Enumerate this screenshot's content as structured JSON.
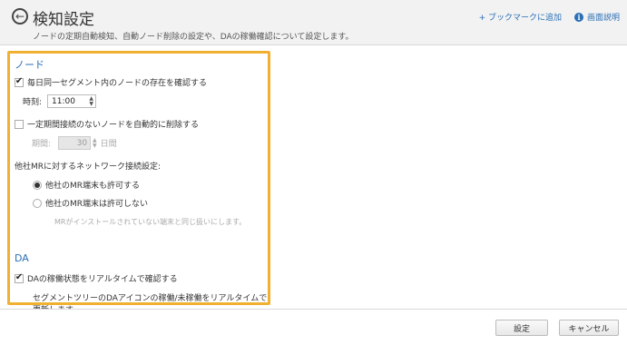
{
  "header": {
    "title": "検知設定",
    "description": "ノードの定期自動検知、自動ノード削除の設定や、DAの稼働確認について設定します。",
    "bookmark_link": "+ ブックマークに追加",
    "help_link": "画面説明"
  },
  "node": {
    "section_title": "ノード",
    "daily_check_label": "毎日同一セグメント内のノードの存在を確認する",
    "daily_check_checked": true,
    "time_label": "時刻:",
    "time_value": "11:00",
    "auto_delete_label": "一定期間接続のないノードを自動的に削除する",
    "auto_delete_checked": false,
    "period_label": "期間:",
    "period_value": "30",
    "period_unit": "日間",
    "other_mr_label": "他社MRに対するネットワーク接続設定:",
    "radio_allow_label": "他社のMR端末も許可する",
    "radio_deny_label": "他社のMR端末は許可しない",
    "radio_selected": "allow",
    "radio_deny_note": "MRがインストールされていない端末と同じ扱いにします。"
  },
  "da": {
    "section_title": "DA",
    "realtime_label": "DAの稼働状態をリアルタイムで確認する",
    "realtime_checked": true,
    "realtime_note": "セグメントツリーのDAアイコンの稼働/未稼働をリアルタイムで更新します。"
  },
  "footer": {
    "save_label": "設定",
    "cancel_label": "キャンセル"
  },
  "colors": {
    "accent": "#2a6fb6",
    "highlight_border": "#f0b132"
  }
}
